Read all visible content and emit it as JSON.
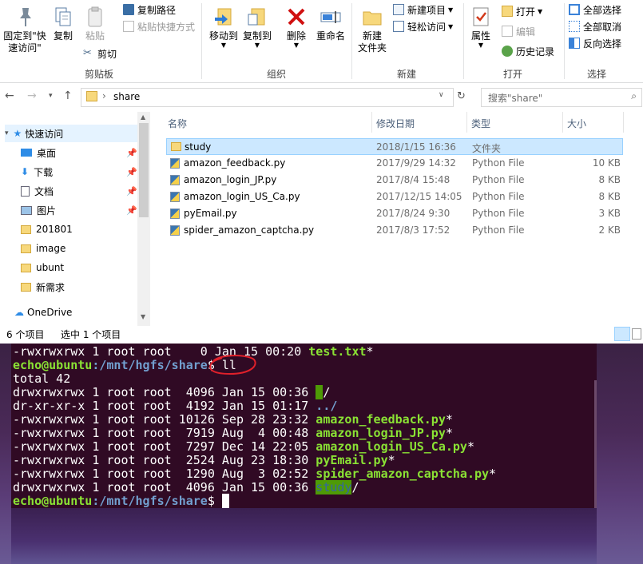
{
  "ribbon": {
    "clipboard": {
      "pin_label_1": "固定到\"快",
      "pin_label_2": "速访问\"",
      "copy": "复制",
      "paste": "粘贴",
      "copy_path": "复制路径",
      "paste_shortcut": "粘贴快捷方式",
      "cut": "剪切",
      "group": "剪贴板"
    },
    "organize": {
      "move_to": "移动到",
      "copy_to": "复制到",
      "delete": "删除",
      "rename": "重命名",
      "group": "组织"
    },
    "new": {
      "new_folder_1": "新建",
      "new_folder_2": "文件夹",
      "new_item": "新建项目",
      "easy_access": "轻松访问",
      "group": "新建"
    },
    "open": {
      "properties": "属性",
      "open": "打开",
      "edit": "编辑",
      "history": "历史记录",
      "group": "打开"
    },
    "select": {
      "select_all": "全部选择",
      "select_none": "全部取消",
      "invert": "反向选择",
      "group": "选择"
    }
  },
  "address": {
    "path": "share",
    "search_placeholder": "搜索\"share\""
  },
  "nav": {
    "items": [
      {
        "label": "快速访问",
        "icon": "star-icon"
      },
      {
        "label": "桌面",
        "icon": "desktop-icon"
      },
      {
        "label": "下载",
        "icon": "download-icon"
      },
      {
        "label": "文档",
        "icon": "document-icon"
      },
      {
        "label": "图片",
        "icon": "picture-icon"
      },
      {
        "label": "201801",
        "icon": "folder-icon"
      },
      {
        "label": "image",
        "icon": "folder-icon"
      },
      {
        "label": "ubunt",
        "icon": "folder-icon"
      },
      {
        "label": "新需求",
        "icon": "folder-icon"
      },
      {
        "label": "OneDrive",
        "icon": "cloud-icon"
      }
    ]
  },
  "files": {
    "columns": {
      "name": "名称",
      "date": "修改日期",
      "type": "类型",
      "size": "大小"
    },
    "rows": [
      {
        "name": "study",
        "date": "2018/1/15 16:36",
        "type": "文件夹",
        "size": "",
        "icon": "folder-icon",
        "selected": true
      },
      {
        "name": "amazon_feedback.py",
        "date": "2017/9/29 14:32",
        "type": "Python File",
        "size": "10 KB",
        "icon": "python-icon"
      },
      {
        "name": "amazon_login_JP.py",
        "date": "2017/8/4 15:48",
        "type": "Python File",
        "size": "8 KB",
        "icon": "python-icon"
      },
      {
        "name": "amazon_login_US_Ca.py",
        "date": "2017/12/15 14:05",
        "type": "Python File",
        "size": "8 KB",
        "icon": "python-icon"
      },
      {
        "name": "pyEmail.py",
        "date": "2017/8/24 9:30",
        "type": "Python File",
        "size": "3 KB",
        "icon": "python-icon"
      },
      {
        "name": "spider_amazon_captcha.py",
        "date": "2017/8/3 17:52",
        "type": "Python File",
        "size": "2 KB",
        "icon": "python-icon"
      }
    ]
  },
  "status": {
    "count": "6 个项目",
    "selected": "选中 1 个项目"
  },
  "terminal": {
    "line0_perm": "-rwxrwxrwx 1 root root    0 Jan 15 00:20 ",
    "line0_file": "test.txt",
    "line0_star": "*",
    "prompt_user": "echo@ubuntu",
    "prompt_path": ":/mnt/hgfs/share",
    "prompt_dollar": "$ ",
    "cmd": "ll",
    "total": "total 42",
    "entries": [
      {
        "perm": "drwxrwxrwx 1 root root  4096 Jan 15 00:36 ",
        "name": "",
        "suffix": "/",
        "kind": "dir-hl"
      },
      {
        "perm": "dr-xr-xr-x 1 root root  4192 Jan 15 01:17 ",
        "name": "../",
        "suffix": "",
        "kind": "dir"
      },
      {
        "perm": "-rwxrwxrwx 1 root root 10126 Sep 28 23:32 ",
        "name": "amazon_feedback.py",
        "suffix": "*",
        "kind": "exec"
      },
      {
        "perm": "-rwxrwxrwx 1 root root  7919 Aug  4 00:48 ",
        "name": "amazon_login_JP.py",
        "suffix": "*",
        "kind": "exec"
      },
      {
        "perm": "-rwxrwxrwx 1 root root  7297 Dec 14 22:05 ",
        "name": "amazon_login_US_Ca.py",
        "suffix": "*",
        "kind": "exec"
      },
      {
        "perm": "-rwxrwxrwx 1 root root  2524 Aug 23 18:30 ",
        "name": "pyEmail.py",
        "suffix": "*",
        "kind": "exec"
      },
      {
        "perm": "-rwxrwxrwx 1 root root  1290 Aug  3 02:52 ",
        "name": "spider_amazon_captcha.py",
        "suffix": "*",
        "kind": "exec"
      },
      {
        "perm": "drwxrwxrwx 1 root root  4096 Jan 15 00:36 ",
        "name": "study",
        "suffix": "/",
        "kind": "dir-hl"
      }
    ]
  }
}
